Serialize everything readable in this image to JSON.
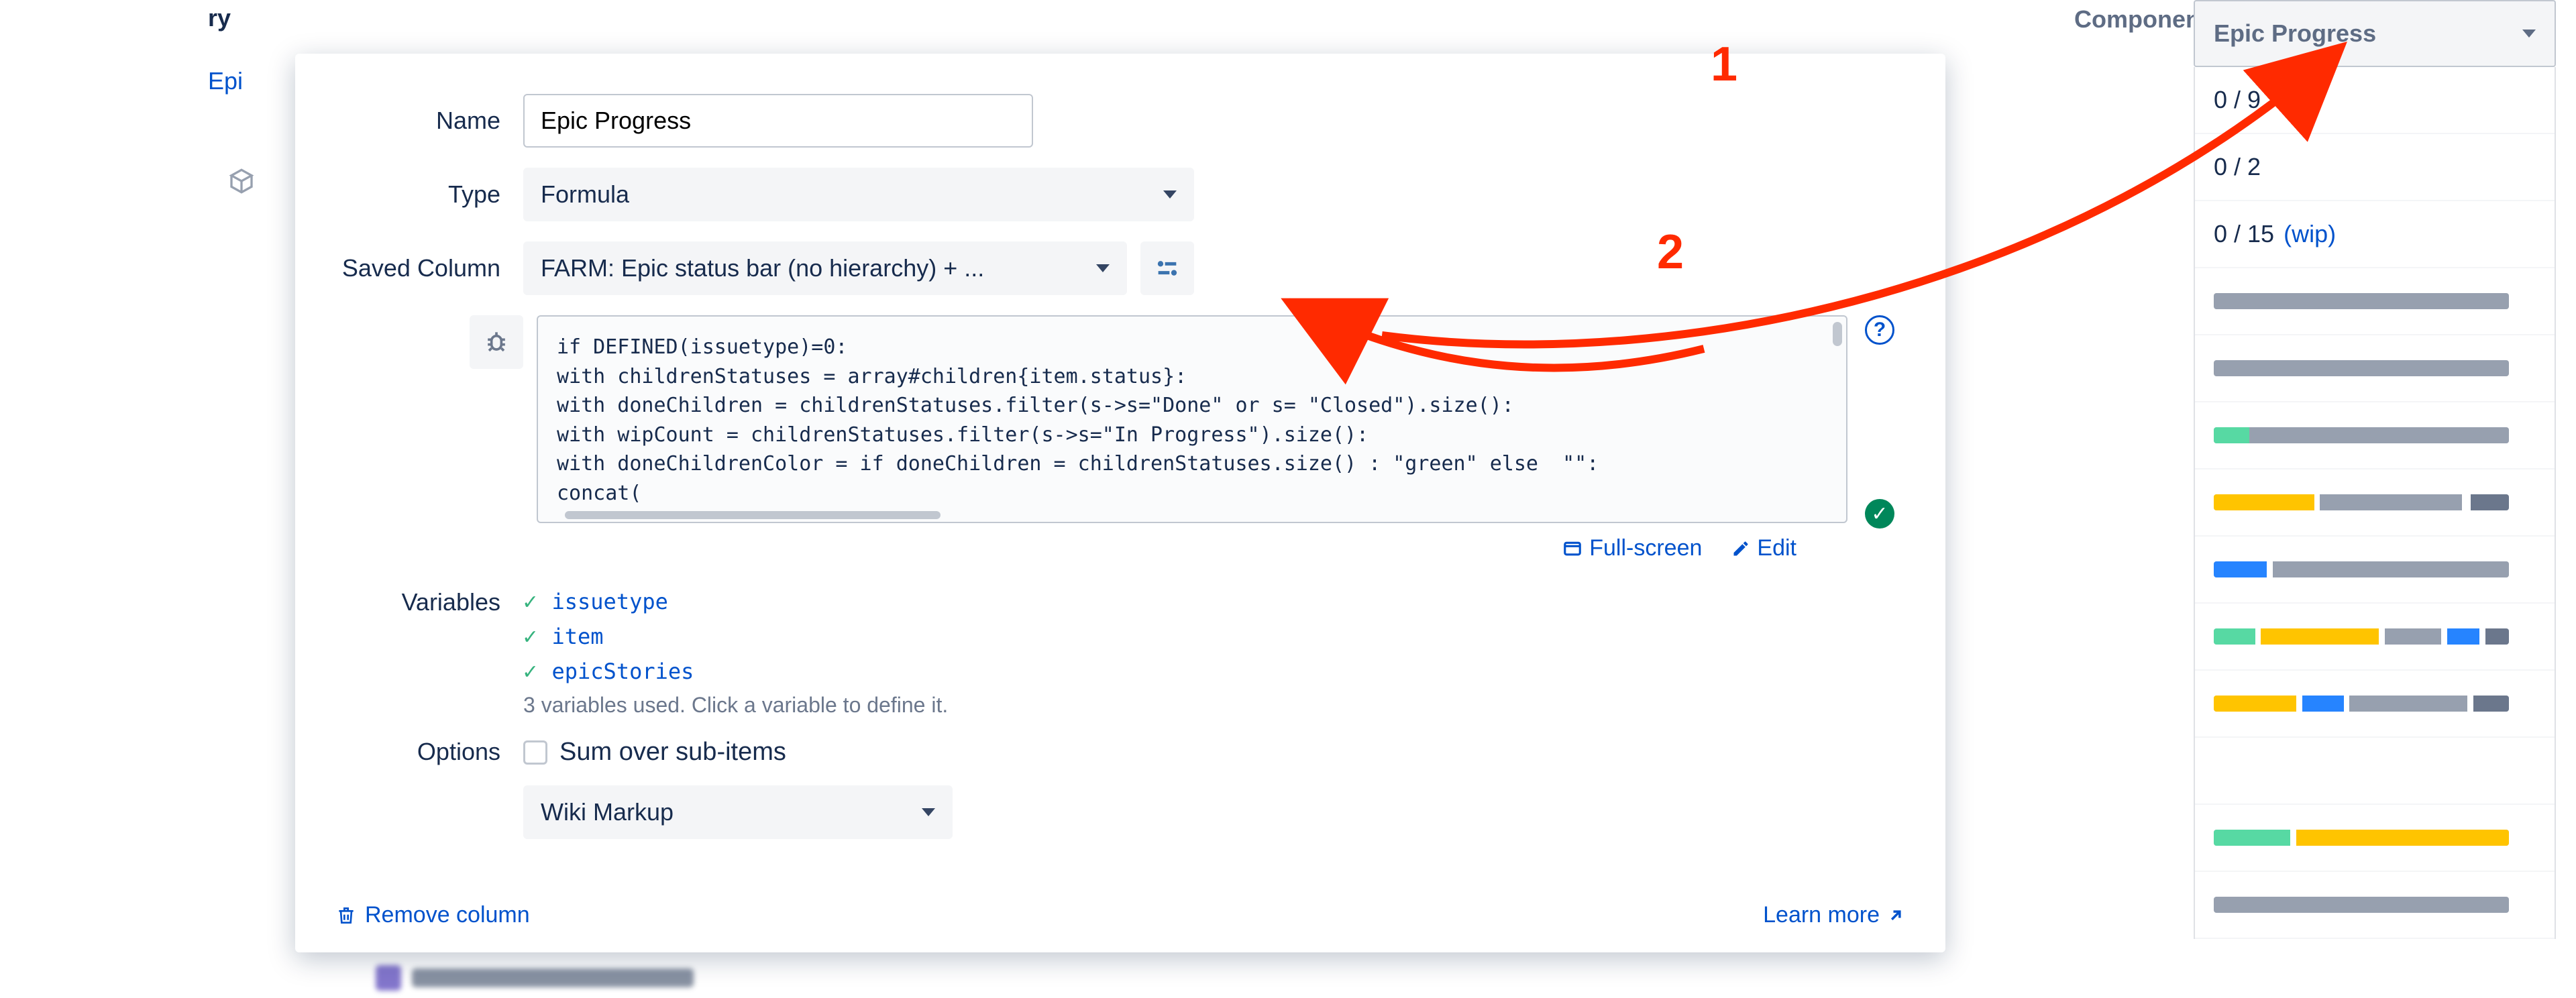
{
  "header": {
    "fragment_left": "ry",
    "col_component_fragment": "Componen",
    "col_epic_progress": "Epic Progress"
  },
  "left_crop": {
    "epi_fragment": "Epi"
  },
  "panel": {
    "labels": {
      "name": "Name",
      "type": "Type",
      "saved_column": "Saved Column",
      "variables": "Variables",
      "options": "Options"
    },
    "name_value": "Epic Progress",
    "type_value": "Formula",
    "saved_column_value": "FARM: Epic status bar (no hierarchy) + ...",
    "formula_code": "if DEFINED(issuetype)=0:\nwith childrenStatuses = array#children{item.status}:\nwith doneChildren = childrenStatuses.filter(s->s=\"Done\" or s= \"Closed\").size():\nwith wipCount = childrenStatuses.filter(s->s=\"In Progress\").size():\nwith doneChildrenColor = if doneChildren = childrenStatuses.size() : \"green\" else  \"\":\nconcat(",
    "code_actions": {
      "fullscreen": "Full-screen",
      "edit": "Edit"
    },
    "variables": [
      "issuetype",
      "item",
      "epicStories"
    ],
    "variables_note": "3 variables used. Click a variable to define it.",
    "options": {
      "checkbox_label": "Sum over sub-items",
      "format_select": "Wiki Markup"
    },
    "footer": {
      "remove": "Remove column",
      "learn_more": "Learn more"
    }
  },
  "epic_progress_column": {
    "rows": [
      {
        "kind": "text",
        "left": "0",
        "right": "9"
      },
      {
        "kind": "text",
        "left": "0",
        "right": "2"
      },
      {
        "kind": "text",
        "left": "0",
        "right": "15",
        "wip": "(wip)"
      },
      {
        "kind": "bar",
        "segments": [
          {
            "c": "#97a0af",
            "w": 100
          }
        ]
      },
      {
        "kind": "bar",
        "segments": [
          {
            "c": "#97a0af",
            "w": 100
          }
        ]
      },
      {
        "kind": "bar",
        "segments": [
          {
            "c": "#57d9a3",
            "w": 12
          },
          {
            "c": "#97a0af",
            "w": 88
          }
        ]
      },
      {
        "kind": "bar",
        "segments": [
          {
            "c": "#ffc400",
            "w": 34
          },
          {
            "c": "#fff",
            "w": 2
          },
          {
            "c": "#97a0af",
            "w": 48
          },
          {
            "c": "#fff",
            "w": 3
          },
          {
            "c": "#6b778c",
            "w": 13
          }
        ]
      },
      {
        "kind": "bar",
        "segments": [
          {
            "c": "#2684ff",
            "w": 18
          },
          {
            "c": "#fff",
            "w": 2
          },
          {
            "c": "#97a0af",
            "w": 80
          }
        ]
      },
      {
        "kind": "bar",
        "segments": [
          {
            "c": "#57d9a3",
            "w": 14
          },
          {
            "c": "#fff",
            "w": 2
          },
          {
            "c": "#ffc400",
            "w": 40
          },
          {
            "c": "#fff",
            "w": 2
          },
          {
            "c": "#97a0af",
            "w": 19
          },
          {
            "c": "#fff",
            "w": 2
          },
          {
            "c": "#2684ff",
            "w": 11
          },
          {
            "c": "#fff",
            "w": 2
          },
          {
            "c": "#6b778c",
            "w": 8
          }
        ]
      },
      {
        "kind": "bar",
        "segments": [
          {
            "c": "#ffc400",
            "w": 28
          },
          {
            "c": "#fff",
            "w": 2
          },
          {
            "c": "#2684ff",
            "w": 14
          },
          {
            "c": "#fff",
            "w": 2
          },
          {
            "c": "#97a0af",
            "w": 40
          },
          {
            "c": "#fff",
            "w": 2
          },
          {
            "c": "#6b778c",
            "w": 12
          }
        ]
      },
      {
        "kind": "empty"
      },
      {
        "kind": "bar",
        "segments": [
          {
            "c": "#57d9a3",
            "w": 26
          },
          {
            "c": "#fff",
            "w": 2
          },
          {
            "c": "#ffc400",
            "w": 72
          }
        ]
      },
      {
        "kind": "bar",
        "segments": [
          {
            "c": "#97a0af",
            "w": 100
          }
        ]
      }
    ]
  },
  "annotations": {
    "num1": "1",
    "num2": "2"
  },
  "icons": {
    "bug": "bug-icon",
    "sliders": "sliders-icon",
    "help": "help-icon",
    "ok": "check-circle-icon",
    "fullscreen": "fullscreen-icon",
    "edit": "pencil-icon",
    "trash": "trash-icon",
    "arrow_out": "arrow-top-right-icon",
    "cube": "cube-icon"
  }
}
